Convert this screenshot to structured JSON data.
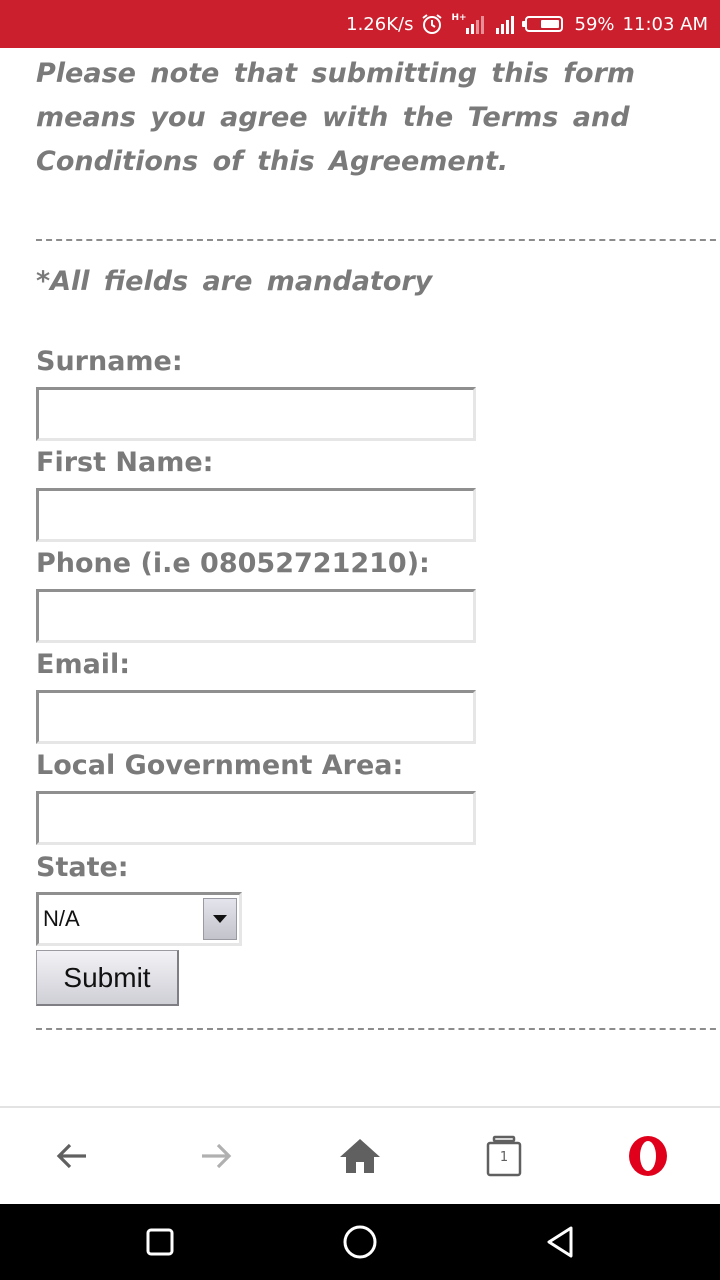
{
  "status_bar": {
    "net_speed": "1.26K/s",
    "network_type": "H+",
    "battery": "59%",
    "battery_level": 0.59,
    "time": "11:03 AM",
    "background_color": "#cc1f2d"
  },
  "page": {
    "notice": "Please note that submitting this form means you agree with the Terms and Conditions of this Agreement.",
    "mandatory_note": "*All fields are mandatory",
    "fields": {
      "surname": {
        "label": "Surname:",
        "value": ""
      },
      "first_name": {
        "label": "First Name:",
        "value": ""
      },
      "phone": {
        "label": "Phone (i.e 08052721210):",
        "value": ""
      },
      "email": {
        "label": "Email:",
        "value": ""
      },
      "lga": {
        "label": "Local Government Area:",
        "value": ""
      },
      "state": {
        "label": "State:",
        "selected": "N/A"
      }
    },
    "submit_label": "Submit",
    "text_color": "#7a7a7a"
  },
  "browser_toolbar": {
    "tab_count": "1",
    "icons": [
      "back-arrow-icon",
      "forward-arrow-icon",
      "home-icon",
      "tabs-icon",
      "opera-menu-icon"
    ],
    "brand_color": "#e0001b"
  },
  "system_nav": {
    "icons": [
      "recents-square-icon",
      "home-circle-icon",
      "back-triangle-icon"
    ]
  }
}
